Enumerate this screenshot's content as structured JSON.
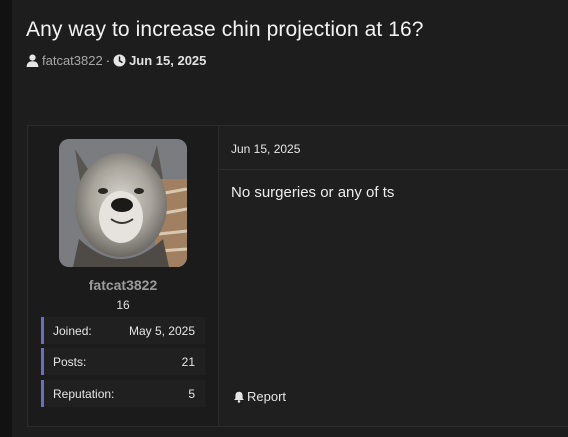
{
  "thread": {
    "title": "Any way to increase chin projection at 16?",
    "author": "fatcat3822",
    "separator": "·",
    "date": "Jun 15, 2025"
  },
  "post": {
    "date": "Jun 15, 2025",
    "body": "No surgeries or any of ts",
    "report_label": "Report"
  },
  "user": {
    "name": "fatcat3822",
    "title": "16",
    "stats": [
      {
        "label": "Joined:",
        "value": "May 5, 2025"
      },
      {
        "label": "Posts:",
        "value": "21"
      },
      {
        "label": "Reputation:",
        "value": "5"
      }
    ]
  },
  "icons": {
    "author": "user-icon",
    "date": "clock-icon",
    "report": "bell-icon"
  },
  "colors": {
    "accent": "#6a6fc4",
    "background": "#1d1d1d"
  }
}
